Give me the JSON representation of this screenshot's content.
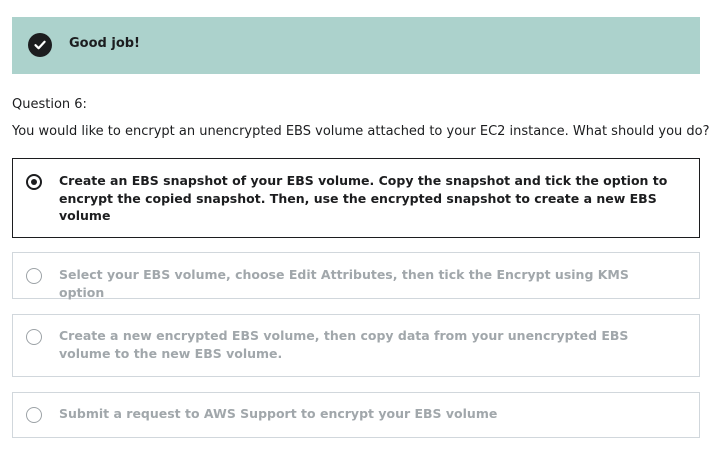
{
  "banner": {
    "icon": "check-circle-icon",
    "text": "Good job!",
    "background": "#acd2cc"
  },
  "question": {
    "number_label": "Question 6:",
    "text": "You would like to encrypt an unencrypted EBS volume attached to your EC2 instance. What should you do?"
  },
  "options": [
    {
      "label": "Create an EBS snapshot of your EBS volume. Copy the snapshot and tick the option to encrypt the copied snapshot. Then, use the encrypted snapshot to create a new EBS volume",
      "selected": true
    },
    {
      "label": "Select your EBS volume, choose Edit Attributes, then tick the Encrypt using KMS option",
      "selected": false
    },
    {
      "label": "Create a new encrypted EBS volume, then copy data from your unencrypted EBS volume to the new EBS volume.",
      "selected": false
    },
    {
      "label": "Submit a request to AWS Support to encrypt your EBS volume",
      "selected": false
    }
  ]
}
